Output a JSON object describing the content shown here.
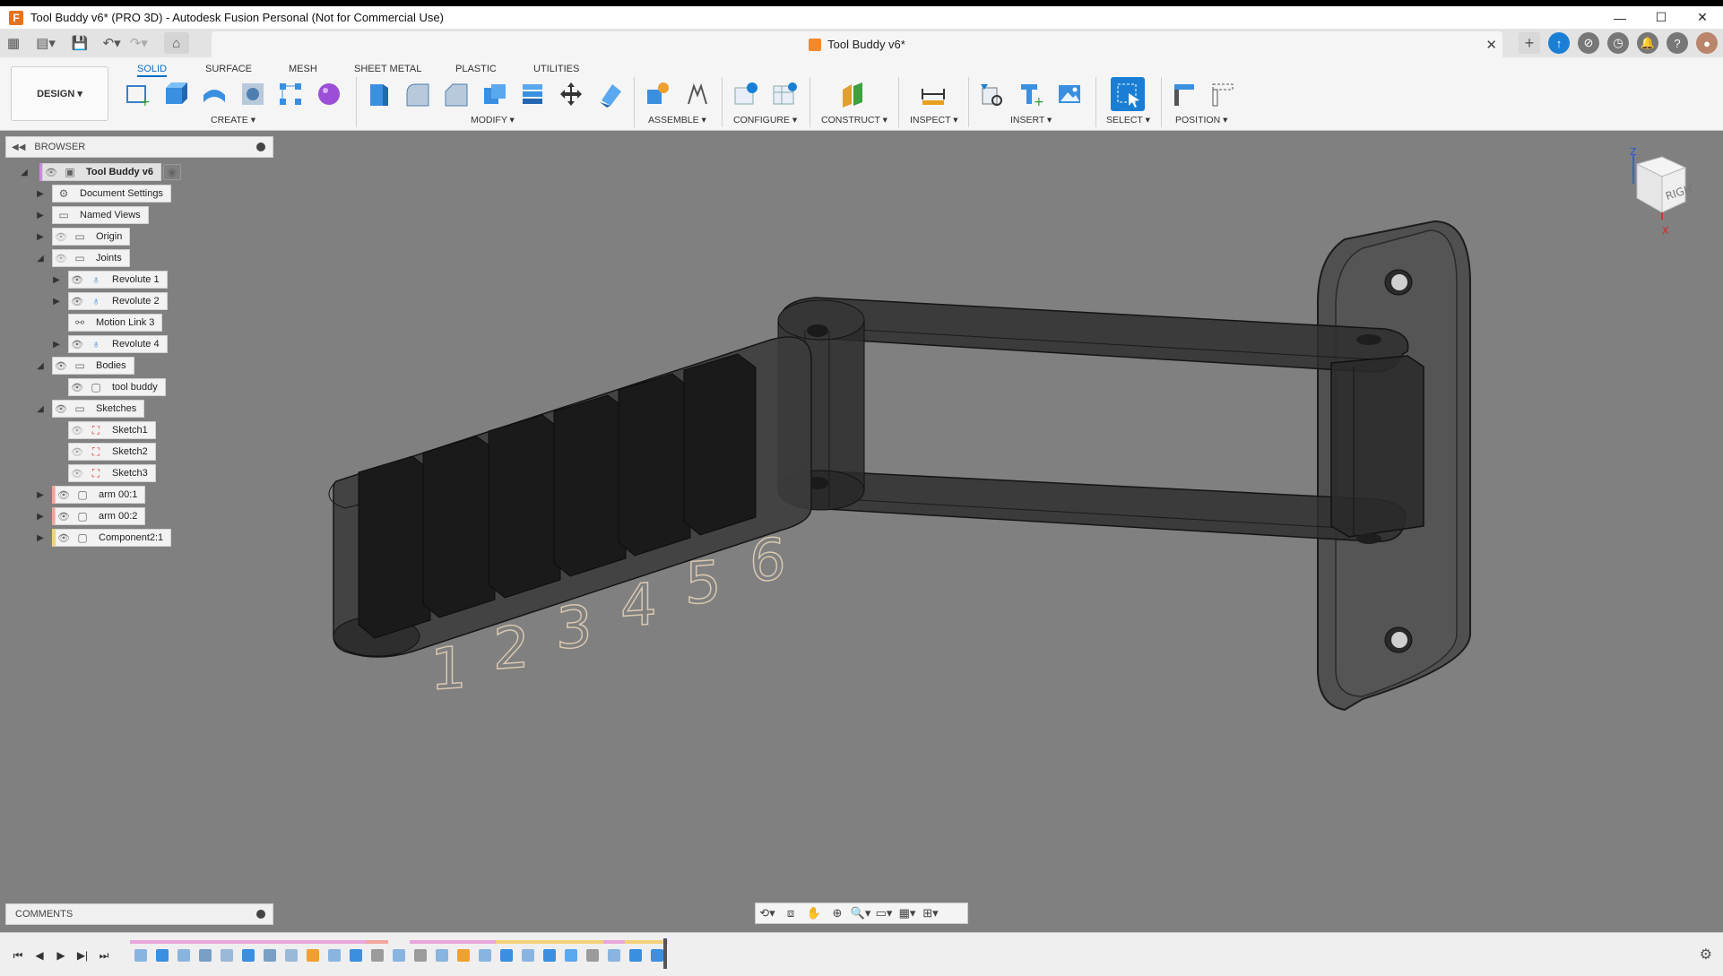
{
  "window": {
    "title": "Tool Buddy v6* (PRO 3D) - Autodesk Fusion Personal (Not for Commercial Use)",
    "app_icon": "F",
    "controls": [
      "—",
      "☐",
      "✕"
    ]
  },
  "tabbar": {
    "doc_tab": "Tool Buddy v6*",
    "close": "✕",
    "add": "+"
  },
  "toolbar": {
    "workspace": "DESIGN ▾",
    "tabs": [
      {
        "label": "SOLID",
        "active": true
      },
      {
        "label": "SURFACE"
      },
      {
        "label": "MESH"
      },
      {
        "label": "SHEET METAL"
      },
      {
        "label": "PLASTIC"
      },
      {
        "label": "UTILITIES"
      }
    ],
    "groups": [
      {
        "label": "CREATE ▾"
      },
      {
        "label": "MODIFY ▾"
      },
      {
        "label": "ASSEMBLE ▾"
      },
      {
        "label": "CONFIGURE ▾"
      },
      {
        "label": "CONSTRUCT ▾"
      },
      {
        "label": "INSPECT ▾"
      },
      {
        "label": "INSERT ▾"
      },
      {
        "label": "SELECT ▾"
      },
      {
        "label": "POSITION ▾"
      }
    ]
  },
  "browser": {
    "title": "BROWSER",
    "items": [
      {
        "label": "Tool Buddy v6"
      },
      {
        "label": "Document Settings"
      },
      {
        "label": "Named Views"
      },
      {
        "label": "Origin"
      },
      {
        "label": "Joints"
      },
      {
        "label": "Revolute 1"
      },
      {
        "label": "Revolute 2"
      },
      {
        "label": "Motion Link 3"
      },
      {
        "label": "Revolute 4"
      },
      {
        "label": "Bodies"
      },
      {
        "label": "tool buddy"
      },
      {
        "label": "Sketches"
      },
      {
        "label": "Sketch1"
      },
      {
        "label": "Sketch2"
      },
      {
        "label": "Sketch3"
      },
      {
        "label": "arm 00:1"
      },
      {
        "label": "arm 00:2"
      },
      {
        "label": "Component2:1"
      }
    ]
  },
  "comments": {
    "title": "COMMENTS"
  },
  "viewcube": {
    "face": "RIGHT",
    "axis_z": "Z",
    "axis_x": "X"
  },
  "model": {
    "digits": [
      "1",
      "2",
      "3",
      "4",
      "5",
      "6"
    ]
  },
  "colors": {
    "accent": "#0e6fc5",
    "viewport": "#808080",
    "timeline_pink": "#e9a6dc",
    "timeline_salmon": "#f2a59a",
    "timeline_yellow": "#f4d27a"
  }
}
